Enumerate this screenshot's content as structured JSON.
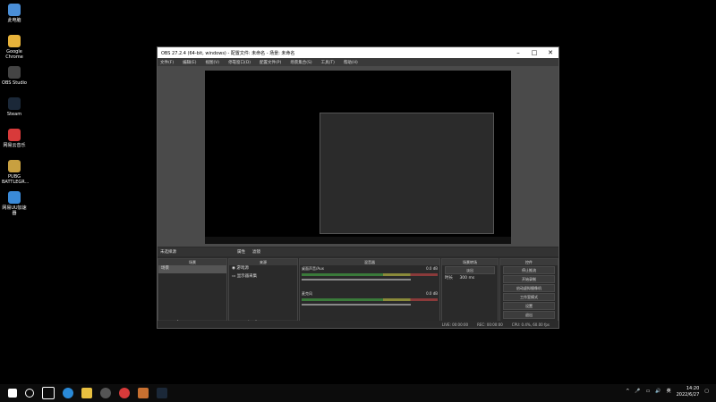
{
  "desktop": {
    "icons": [
      {
        "label": "此电脑",
        "color": "#4a8fd8"
      },
      {
        "label": "Google Chrome",
        "color": "#e8b33a"
      },
      {
        "label": "OBS Studio",
        "color": "#444444"
      },
      {
        "label": "Steam",
        "color": "#1b2838"
      },
      {
        "label": "网易云音乐",
        "color": "#d83a3a"
      },
      {
        "label": "PUBG BATTLEGR...",
        "color": "#c8a040"
      },
      {
        "label": "网易UU加速器",
        "color": "#3a8ad8"
      }
    ]
  },
  "obs": {
    "title": "OBS 27.2.4 (64-bit, windows) - 配置文件: 未命名 - 场景: 未命名",
    "menu": [
      "文件(F)",
      "编辑(E)",
      "视图(V)",
      "停靠窗口(D)",
      "配置文件(P)",
      "场景集合(S)",
      "工具(T)",
      "帮助(H)"
    ],
    "scene_strip": {
      "label": "未选择源",
      "props": "属性",
      "filters": "滤镜"
    },
    "docks": {
      "scenes": {
        "header": "场景",
        "items": [
          "场景"
        ]
      },
      "sources": {
        "header": "来源",
        "items": [
          "游戏源",
          "显示器采集"
        ]
      },
      "mixer": {
        "header": "混音器",
        "channels": [
          {
            "name": "桌面声音/Aux",
            "db": "0.0 dB"
          },
          {
            "name": "麦克风",
            "db": "0.0 dB"
          }
        ]
      },
      "transitions": {
        "header": "场景转场",
        "type": "淡出",
        "duration_label": "时长",
        "duration": "300 ms"
      },
      "controls": {
        "header": "控件",
        "buttons": [
          "停止推流",
          "开始录制",
          "启动虚拟摄像机",
          "工作室模式",
          "设置",
          "退出"
        ]
      }
    },
    "status": {
      "live": "LIVE: 00:00:00",
      "rec": "REC: 00:00:00",
      "cpu": "CPU: 0.4%, 60.00 fps"
    }
  },
  "taskbar": {
    "time": "14:20",
    "date": "2022/6/27",
    "lang": "英"
  }
}
